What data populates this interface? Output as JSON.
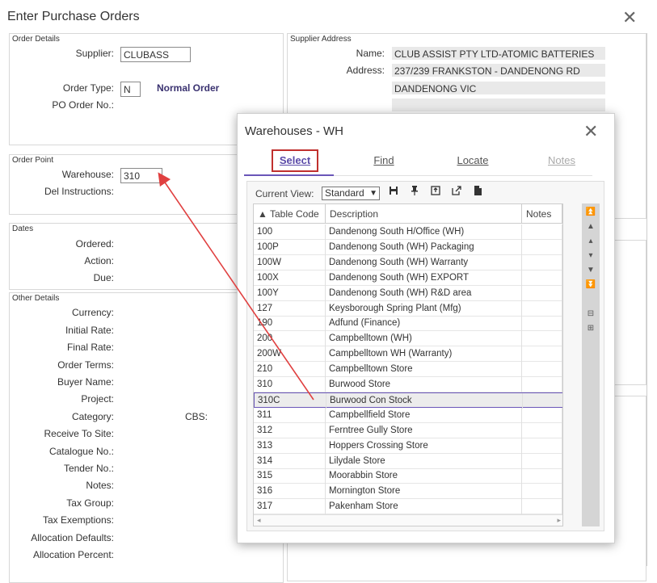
{
  "window": {
    "title": "Enter Purchase Orders"
  },
  "order_details": {
    "group_label": "Order Details",
    "supplier_label": "Supplier:",
    "supplier_value": "CLUBASS",
    "order_type_label": "Order Type:",
    "order_type_value": "N",
    "order_type_desc": "Normal Order",
    "po_order_label": "PO Order No.:"
  },
  "supplier_address": {
    "group_label": "Supplier Address",
    "name_label": "Name:",
    "name_value": "CLUB ASSIST PTY LTD-ATOMIC BATTERIES",
    "address_label": "Address:",
    "address_line1": "237/239 FRANKSTON - DANDENONG RD",
    "address_line2": "DANDENONG   VIC",
    "address_line3": ""
  },
  "order_point": {
    "group_label": "Order Point",
    "warehouse_label": "Warehouse:",
    "warehouse_value": "310",
    "del_instructions_label": "Del Instructions:"
  },
  "dates": {
    "group_label": "Dates",
    "ordered_label": "Ordered:",
    "action_label": "Action:",
    "due_label": "Due:"
  },
  "other_details": {
    "group_label": "Other Details",
    "labels": [
      "Currency:",
      "Initial Rate:",
      "Final Rate:",
      "Order Terms:",
      "Buyer Name:",
      "Project:",
      "Category:",
      "Receive To Site:",
      "Catalogue No.:",
      "Tender No.:",
      "Notes:",
      "Tax Group:",
      "Tax Exemptions:",
      "Allocation Defaults:",
      "Allocation Percent:"
    ],
    "cbs_label": "CBS:"
  },
  "popup": {
    "title": "Warehouses - WH",
    "tabs": [
      "Select",
      "Find",
      "Locate",
      "Notes"
    ],
    "current_view_label": "Current View:",
    "current_view_value": "Standard",
    "columns": [
      "▲ Table Code",
      "Description",
      "Notes"
    ],
    "rows": [
      [
        "100",
        "Dandenong South H/Office (WH)",
        ""
      ],
      [
        "100P",
        "Dandenong South (WH) Packaging",
        ""
      ],
      [
        "100W",
        "Dandenong South (WH) Warranty",
        ""
      ],
      [
        "100X",
        "Dandenong South (WH) EXPORT",
        ""
      ],
      [
        "100Y",
        "Dandenong South (WH) R&D area",
        ""
      ],
      [
        "127",
        "Keysborough Spring Plant (Mfg)",
        ""
      ],
      [
        "190",
        "Adfund (Finance)",
        ""
      ],
      [
        "200",
        "Campbelltown (WH)",
        ""
      ],
      [
        "200W",
        "Campbelltown WH (Warranty)",
        ""
      ],
      [
        "210",
        "Campbelltown Store",
        ""
      ],
      [
        "310",
        "Burwood Store",
        ""
      ],
      [
        "310C",
        "Burwood Con Stock",
        ""
      ],
      [
        "311",
        "Campbellfield Store",
        ""
      ],
      [
        "312",
        "Ferntree Gully Store",
        ""
      ],
      [
        "313",
        "Hoppers Crossing Store",
        ""
      ],
      [
        "314",
        "Lilydale Store",
        ""
      ],
      [
        "315",
        "Moorabbin Store",
        ""
      ],
      [
        "316",
        "Mornington Store",
        ""
      ],
      [
        "317",
        "Pakenham Store",
        ""
      ]
    ],
    "selected_row": 11
  },
  "icons": {
    "close": "✕",
    "save": "save-icon",
    "pin": "pin-icon",
    "export": "export-icon",
    "open": "open-external-icon",
    "document": "document-icon"
  },
  "colors": {
    "accent": "#6a56b8",
    "highlight_red": "#c0302e",
    "arrow_red": "#e04040"
  }
}
